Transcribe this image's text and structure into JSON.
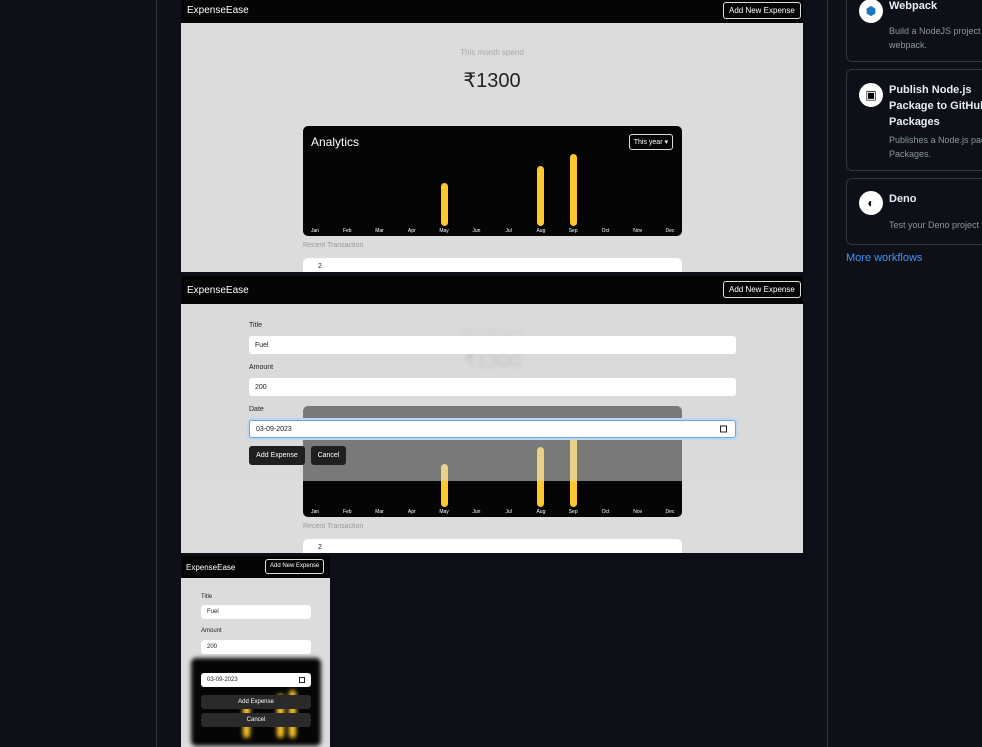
{
  "app": {
    "brand": "ExpenseEase",
    "add_button": "Add New Expense"
  },
  "home": {
    "spend_label": "This month spend",
    "spend_value": "₹1300",
    "analytics_title": "Analytics",
    "period": "This year",
    "recent_label": "Recent Transaction",
    "tx_number": "2",
    "months": [
      "Jan",
      "Feb",
      "Mar",
      "Apr",
      "May",
      "Jun",
      "Jul",
      "Aug",
      "Sep",
      "Oct",
      "Nov",
      "Dec"
    ],
    "chart_data": {
      "type": "bar",
      "categories": [
        "Jan",
        "Feb",
        "Mar",
        "Apr",
        "May",
        "Jun",
        "Jul",
        "Aug",
        "Sep",
        "Oct",
        "Nov",
        "Dec"
      ],
      "values": [
        0,
        0,
        0,
        0,
        300,
        0,
        0,
        420,
        500,
        0,
        0,
        0
      ]
    }
  },
  "form": {
    "title_label": "Title",
    "title_value": "Fuel",
    "amount_label": "Amount",
    "amount_value": "200",
    "date_label": "Date",
    "date_value": "03-09-2023",
    "submit_label": "Add Expense",
    "cancel_label": "Cancel"
  },
  "sidebar": {
    "workflows": [
      {
        "title": "Webpack",
        "desc_lines": [
          "Build a NodeJS project w",
          "webpack."
        ]
      },
      {
        "title_lines": [
          "Publish Node.js",
          "Package to GitHub",
          "Packages"
        ],
        "desc_lines": [
          "Publishes a Node.js pac",
          "Packages."
        ]
      },
      {
        "title": "Deno",
        "desc_lines": [
          "Test your Deno project"
        ]
      }
    ],
    "more_link": "More workflows"
  },
  "colors": {
    "bar": "#ffc72c",
    "link": "#4493f8",
    "page_bg": "#0d1117"
  }
}
